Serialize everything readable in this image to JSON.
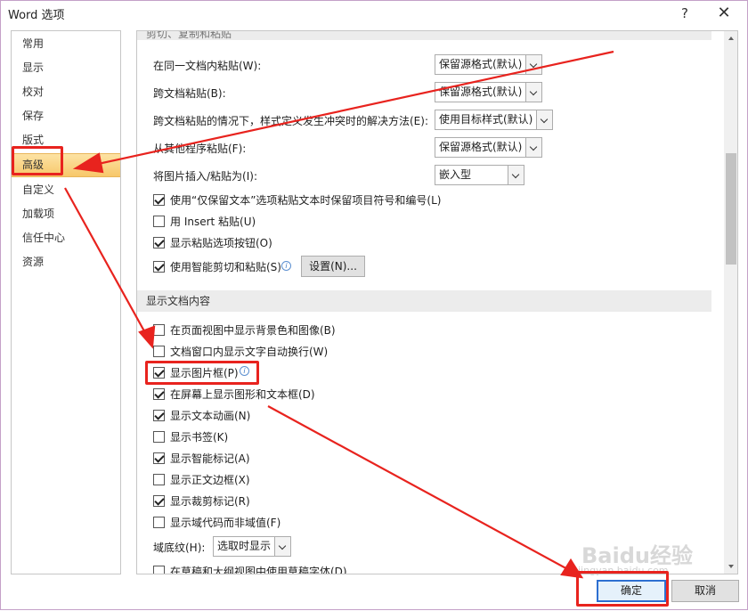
{
  "window": {
    "title": "Word 选项",
    "help_label": "?",
    "close_label": "✕"
  },
  "nav": {
    "items": [
      {
        "label": "常用"
      },
      {
        "label": "显示"
      },
      {
        "label": "校对"
      },
      {
        "label": "保存"
      },
      {
        "label": "版式"
      },
      {
        "label": "高级",
        "selected": true
      },
      {
        "label": "自定义"
      },
      {
        "label": "加载项"
      },
      {
        "label": "信任中心"
      },
      {
        "label": "资源"
      }
    ]
  },
  "paste_section": {
    "title": "剪切、复制和粘贴",
    "dropdown_rows": [
      {
        "label": "在同一文档内粘贴(W):",
        "value": "保留源格式(默认)"
      },
      {
        "label": "跨文档粘贴(B):",
        "value": "保留源格式(默认)"
      },
      {
        "label": "跨文档粘贴的情况下，样式定义发生冲突时的解决方法(E):",
        "value": "使用目标样式(默认)"
      },
      {
        "label": "从其他程序粘贴(F):",
        "value": "保留源格式(默认)"
      },
      {
        "label": "将图片插入/粘贴为(I):",
        "value": "嵌入型"
      }
    ],
    "checkboxes": [
      {
        "label": "使用“仅保留文本”选项粘贴文本时保留项目符号和编号(L)",
        "checked": true
      },
      {
        "label": "用 Insert 粘贴(U)",
        "checked": false
      },
      {
        "label": "显示粘贴选项按钮(O)",
        "checked": true
      },
      {
        "label": "使用智能剪切和粘贴(S)",
        "checked": true
      }
    ],
    "settings_button": "设置(N)..."
  },
  "display_section": {
    "title": "显示文档内容",
    "checkboxes": [
      {
        "label": "在页面视图中显示背景色和图像(B)",
        "checked": false
      },
      {
        "label": "文档窗口内显示文字自动换行(W)",
        "checked": false
      },
      {
        "label": "显示图片框(P)",
        "checked": true
      },
      {
        "label": "在屏幕上显示图形和文本框(D)",
        "checked": true
      },
      {
        "label": "显示文本动画(N)",
        "checked": true
      },
      {
        "label": "显示书签(K)",
        "checked": false
      },
      {
        "label": "显示智能标记(A)",
        "checked": true
      },
      {
        "label": "显示正文边框(X)",
        "checked": false
      },
      {
        "label": "显示裁剪标记(R)",
        "checked": true
      },
      {
        "label": "显示域代码而非域值(F)",
        "checked": false
      }
    ],
    "shading_label": "域底纹(H):",
    "shading_value": "选取时显示",
    "draft_row_label": "在草稿和大纲视图中使用草稿字体(D)"
  },
  "buttons": {
    "ok": "确定",
    "cancel": "取消"
  },
  "watermark": {
    "brand": "Baidu经验",
    "sub": "jingyan.baidu.com"
  },
  "colors": {
    "annotation_red": "#e8231e",
    "selected_nav": "#f7c76a",
    "ok_border": "#2d6fd1"
  }
}
